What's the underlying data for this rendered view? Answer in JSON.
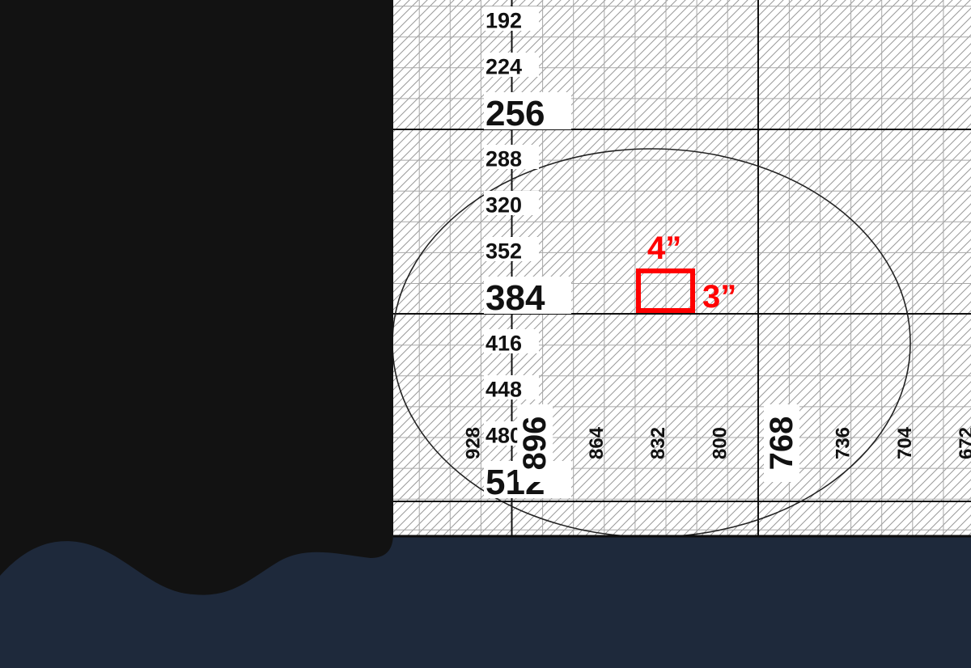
{
  "colors": {
    "dark_panel": "#121212",
    "bottom_band": "#1e293b",
    "paper": "#ffffff",
    "hatch": "#9a9a9a",
    "grid_fine": "#a8a8a8",
    "grid_major": "#111111",
    "annotation": "#ff0000"
  },
  "y_ruler": {
    "labels": [
      {
        "text": "192",
        "major": false
      },
      {
        "text": "224",
        "major": false
      },
      {
        "text": "256",
        "major": true
      },
      {
        "text": "288",
        "major": false
      },
      {
        "text": "320",
        "major": false
      },
      {
        "text": "352",
        "major": false
      },
      {
        "text": "384",
        "major": true
      },
      {
        "text": "416",
        "major": false
      },
      {
        "text": "448",
        "major": false
      },
      {
        "text": "480",
        "major": false
      },
      {
        "text": "512",
        "major": true
      }
    ]
  },
  "x_ruler": {
    "labels": [
      {
        "text": "928",
        "major": false
      },
      {
        "text": "896",
        "major": true
      },
      {
        "text": "864",
        "major": false
      },
      {
        "text": "832",
        "major": false
      },
      {
        "text": "800",
        "major": false
      },
      {
        "text": "768",
        "major": true
      },
      {
        "text": "736",
        "major": false
      },
      {
        "text": "704",
        "major": false
      },
      {
        "text": "672",
        "major": false
      }
    ]
  },
  "annotation": {
    "width_label": "4”",
    "height_label": "3”"
  }
}
